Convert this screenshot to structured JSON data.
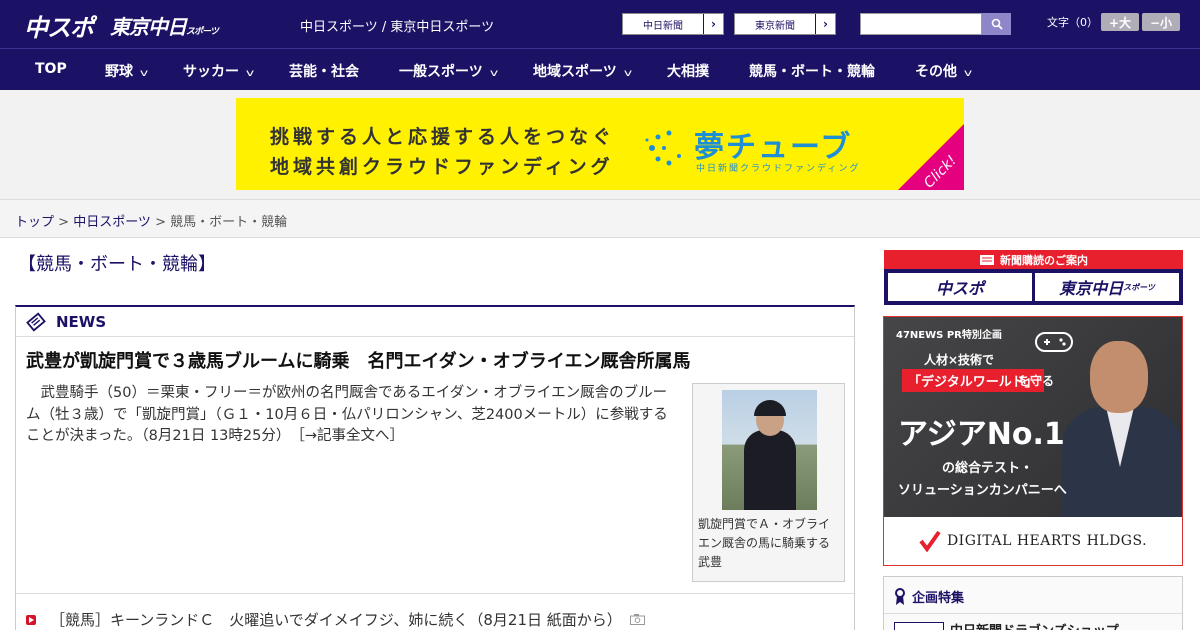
{
  "header": {
    "logo_main": "中スポ",
    "logo_tokyo": "東京中日",
    "logo_tokyo_small": "スポーツ",
    "sitename": "中日スポーツ / 東京中日スポーツ",
    "link_chunichi": "中日新聞",
    "link_tokyo": "東京新聞",
    "search_placeholder": "",
    "fontsize_label": "文字（0）",
    "font_larger": "+大",
    "font_smaller": "−小"
  },
  "nav": {
    "items": [
      {
        "label": "TOP",
        "has_menu": false
      },
      {
        "label": "野球",
        "has_menu": true
      },
      {
        "label": "サッカー",
        "has_menu": true
      },
      {
        "label": "芸能・社会",
        "has_menu": false
      },
      {
        "label": "一般スポーツ",
        "has_menu": true
      },
      {
        "label": "地域スポーツ",
        "has_menu": true
      },
      {
        "label": "大相撲",
        "has_menu": false
      },
      {
        "label": "競馬・ボート・競輪",
        "has_menu": false
      },
      {
        "label": "その他",
        "has_menu": true
      }
    ]
  },
  "banner": {
    "line1": "挑戦する人と応援する人をつなぐ",
    "line2": "地域共創クラウドファンディング",
    "brand": "夢チューブ",
    "brand_sub": "中日新聞クラウドファンディング",
    "click": "Click!"
  },
  "breadcrumb": {
    "top": "トップ",
    "site": "中日スポーツ",
    "current": "競馬・ボート・競輪",
    "sep": " > "
  },
  "main": {
    "section_title": "【競馬・ボート・競輪】",
    "news_label": "NEWS",
    "headline": "武豊が凱旋門賞で３歳馬ブルームに騎乗　名門エイダン・オブライエン厩舎所属馬",
    "body": "　武豊騎手（50）＝栗東・フリー＝が欧州の名門厩舎であるエイダン・オブライエン厩舎のブルーム（牡３歳）で「凱旋門賞」（Ｇ１・10月６日・仏パリロンシャン、芝2400メートル）に参戦することが決まった。（8月21日 13時25分）",
    "more": "［→記事全文へ］",
    "photo_caption": "凱旋門賞でＡ・オブライエン厩舎の馬に騎乗する武豊",
    "list_item": "［競馬］キーンランドＣ　火曜追いでダイメイフジ、姉に続く（8月21日 紙面から）"
  },
  "sidebar": {
    "subs_head": "新聞購読のご案内",
    "subs_logo1": "中スポ",
    "subs_logo2": "東京中日",
    "subs_logo2_small": "スポーツ",
    "ad_pr": "47NEWS PR特別企画",
    "ad_t1": "人材×技術で",
    "ad_t2": "「デジタルワールド」",
    "ad_t2b": "を守る",
    "ad_t3": "アジアNo.1",
    "ad_t4": "の総合テスト・",
    "ad_t5": "ソリューションカンパニーへ",
    "ad_company": "DIGITAL HEARTS HLDGS.",
    "feature_head": "企画特集",
    "feature_item": "中日新聞ドラゴンズショップ"
  },
  "colors": {
    "brand_navy": "#1b1266",
    "accent_red": "#e8202e",
    "banner_yellow": "#fff100"
  }
}
